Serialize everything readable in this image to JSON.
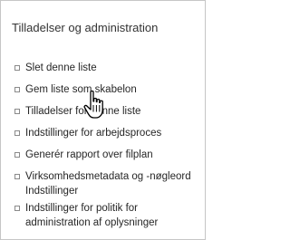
{
  "section": {
    "title": "Tilladelser og administration"
  },
  "links": [
    {
      "label": "Slet denne liste"
    },
    {
      "label": "Gem liste som skabelon"
    },
    {
      "label": "Tilladelser for denne liste"
    },
    {
      "label": "Indstillinger for arbejdsproces"
    },
    {
      "label": "Generér rapport over filplan"
    },
    {
      "label": "Virksomhedsmetadata og -nøgleord Indstillinger"
    },
    {
      "label": "Indstillinger for politik for administration af oplysninger"
    }
  ],
  "cursor": {
    "icon": "hand-pointer-icon"
  },
  "colors": {
    "border": "#c6c6c6",
    "text": "#262626"
  }
}
